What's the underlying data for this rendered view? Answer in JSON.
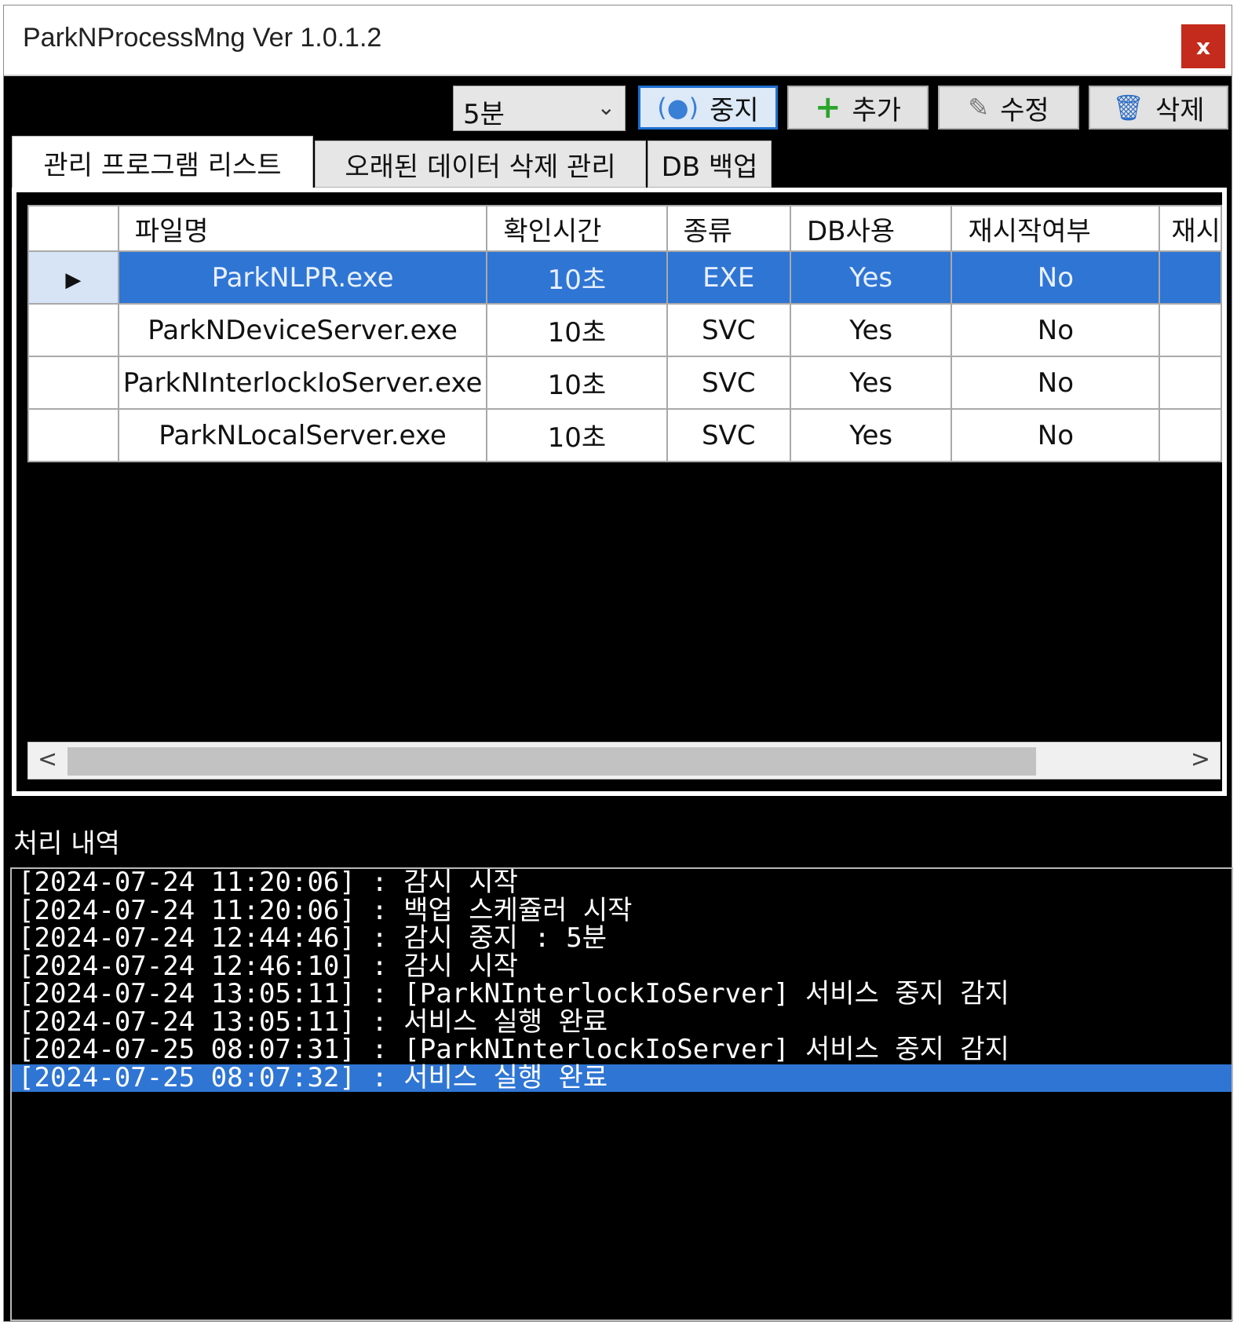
{
  "window": {
    "title": "ParkNProcessMng Ver 1.0.1.2",
    "close_label": "x"
  },
  "toolbar": {
    "interval": "5분",
    "stop_label": "중지",
    "add_label": "추가",
    "edit_label": "수정",
    "delete_label": "삭제"
  },
  "tabs": [
    "관리 프로그램 리스트",
    "오래된 데이터 삭제 관리",
    "DB 백업"
  ],
  "grid": {
    "columns": [
      "파일명",
      "확인시간",
      "종류",
      "DB사용",
      "재시작여부",
      "재시"
    ],
    "rows": [
      {
        "file": "ParkNLPR.exe",
        "time": "10초",
        "type": "EXE",
        "db": "Yes",
        "restart": "No"
      },
      {
        "file": "ParkNDeviceServer.exe",
        "time": "10초",
        "type": "SVC",
        "db": "Yes",
        "restart": "No"
      },
      {
        "file": "ParkNInterlockIoServer.exe",
        "time": "10초",
        "type": "SVC",
        "db": "Yes",
        "restart": "No"
      },
      {
        "file": "ParkNLocalServer.exe",
        "time": "10초",
        "type": "SVC",
        "db": "Yes",
        "restart": "No"
      }
    ],
    "selected_row": 0
  },
  "log": {
    "label": "처리 내역",
    "lines": [
      "[2024-07-24 11:20:06] : 감시 시작",
      "[2024-07-24 11:20:06] : 백업 스케쥴러 시작",
      "[2024-07-24 12:44:46] : 감시 중지 : 5분",
      "[2024-07-24 12:46:10] : 감시 시작",
      "[2024-07-24 13:05:11] : [ParkNInterlockIoServer] 서비스 중지 감지",
      "[2024-07-24 13:05:11] : 서비스 실행 완료",
      "[2024-07-25 08:07:31] : [ParkNInterlockIoServer] 서비스 중지 감지",
      "[2024-07-25 08:07:32] : 서비스 실행 완료"
    ],
    "selected_line": 7
  },
  "colors": {
    "selection": "#2f75d4",
    "close": "#c42b1c",
    "background": "#000000"
  }
}
